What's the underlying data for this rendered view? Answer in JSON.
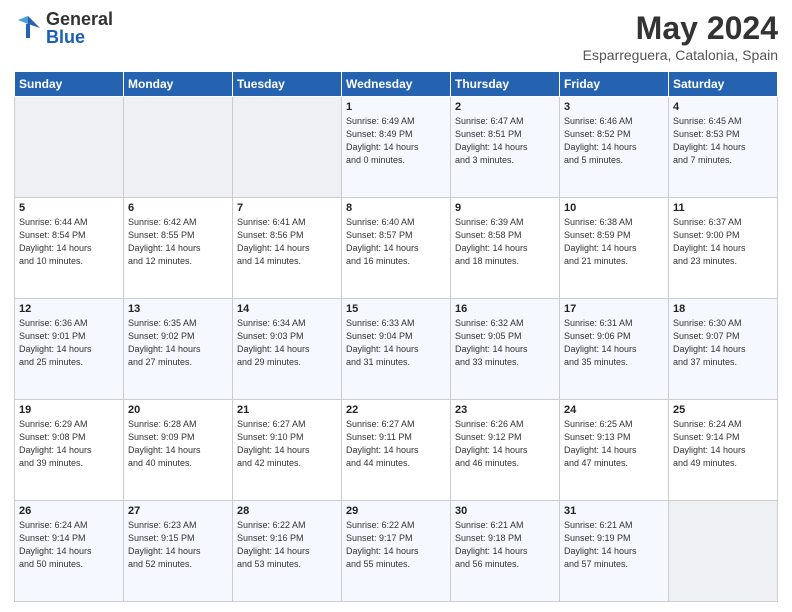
{
  "header": {
    "logo_general": "General",
    "logo_blue": "Blue",
    "month_title": "May 2024",
    "location": "Esparreguera, Catalonia, Spain"
  },
  "weekdays": [
    "Sunday",
    "Monday",
    "Tuesday",
    "Wednesday",
    "Thursday",
    "Friday",
    "Saturday"
  ],
  "weeks": [
    [
      {
        "day": "",
        "info": ""
      },
      {
        "day": "",
        "info": ""
      },
      {
        "day": "",
        "info": ""
      },
      {
        "day": "1",
        "info": "Sunrise: 6:49 AM\nSunset: 8:49 PM\nDaylight: 14 hours\nand 0 minutes."
      },
      {
        "day": "2",
        "info": "Sunrise: 6:47 AM\nSunset: 8:51 PM\nDaylight: 14 hours\nand 3 minutes."
      },
      {
        "day": "3",
        "info": "Sunrise: 6:46 AM\nSunset: 8:52 PM\nDaylight: 14 hours\nand 5 minutes."
      },
      {
        "day": "4",
        "info": "Sunrise: 6:45 AM\nSunset: 8:53 PM\nDaylight: 14 hours\nand 7 minutes."
      }
    ],
    [
      {
        "day": "5",
        "info": "Sunrise: 6:44 AM\nSunset: 8:54 PM\nDaylight: 14 hours\nand 10 minutes."
      },
      {
        "day": "6",
        "info": "Sunrise: 6:42 AM\nSunset: 8:55 PM\nDaylight: 14 hours\nand 12 minutes."
      },
      {
        "day": "7",
        "info": "Sunrise: 6:41 AM\nSunset: 8:56 PM\nDaylight: 14 hours\nand 14 minutes."
      },
      {
        "day": "8",
        "info": "Sunrise: 6:40 AM\nSunset: 8:57 PM\nDaylight: 14 hours\nand 16 minutes."
      },
      {
        "day": "9",
        "info": "Sunrise: 6:39 AM\nSunset: 8:58 PM\nDaylight: 14 hours\nand 18 minutes."
      },
      {
        "day": "10",
        "info": "Sunrise: 6:38 AM\nSunset: 8:59 PM\nDaylight: 14 hours\nand 21 minutes."
      },
      {
        "day": "11",
        "info": "Sunrise: 6:37 AM\nSunset: 9:00 PM\nDaylight: 14 hours\nand 23 minutes."
      }
    ],
    [
      {
        "day": "12",
        "info": "Sunrise: 6:36 AM\nSunset: 9:01 PM\nDaylight: 14 hours\nand 25 minutes."
      },
      {
        "day": "13",
        "info": "Sunrise: 6:35 AM\nSunset: 9:02 PM\nDaylight: 14 hours\nand 27 minutes."
      },
      {
        "day": "14",
        "info": "Sunrise: 6:34 AM\nSunset: 9:03 PM\nDaylight: 14 hours\nand 29 minutes."
      },
      {
        "day": "15",
        "info": "Sunrise: 6:33 AM\nSunset: 9:04 PM\nDaylight: 14 hours\nand 31 minutes."
      },
      {
        "day": "16",
        "info": "Sunrise: 6:32 AM\nSunset: 9:05 PM\nDaylight: 14 hours\nand 33 minutes."
      },
      {
        "day": "17",
        "info": "Sunrise: 6:31 AM\nSunset: 9:06 PM\nDaylight: 14 hours\nand 35 minutes."
      },
      {
        "day": "18",
        "info": "Sunrise: 6:30 AM\nSunset: 9:07 PM\nDaylight: 14 hours\nand 37 minutes."
      }
    ],
    [
      {
        "day": "19",
        "info": "Sunrise: 6:29 AM\nSunset: 9:08 PM\nDaylight: 14 hours\nand 39 minutes."
      },
      {
        "day": "20",
        "info": "Sunrise: 6:28 AM\nSunset: 9:09 PM\nDaylight: 14 hours\nand 40 minutes."
      },
      {
        "day": "21",
        "info": "Sunrise: 6:27 AM\nSunset: 9:10 PM\nDaylight: 14 hours\nand 42 minutes."
      },
      {
        "day": "22",
        "info": "Sunrise: 6:27 AM\nSunset: 9:11 PM\nDaylight: 14 hours\nand 44 minutes."
      },
      {
        "day": "23",
        "info": "Sunrise: 6:26 AM\nSunset: 9:12 PM\nDaylight: 14 hours\nand 46 minutes."
      },
      {
        "day": "24",
        "info": "Sunrise: 6:25 AM\nSunset: 9:13 PM\nDaylight: 14 hours\nand 47 minutes."
      },
      {
        "day": "25",
        "info": "Sunrise: 6:24 AM\nSunset: 9:14 PM\nDaylight: 14 hours\nand 49 minutes."
      }
    ],
    [
      {
        "day": "26",
        "info": "Sunrise: 6:24 AM\nSunset: 9:14 PM\nDaylight: 14 hours\nand 50 minutes."
      },
      {
        "day": "27",
        "info": "Sunrise: 6:23 AM\nSunset: 9:15 PM\nDaylight: 14 hours\nand 52 minutes."
      },
      {
        "day": "28",
        "info": "Sunrise: 6:22 AM\nSunset: 9:16 PM\nDaylight: 14 hours\nand 53 minutes."
      },
      {
        "day": "29",
        "info": "Sunrise: 6:22 AM\nSunset: 9:17 PM\nDaylight: 14 hours\nand 55 minutes."
      },
      {
        "day": "30",
        "info": "Sunrise: 6:21 AM\nSunset: 9:18 PM\nDaylight: 14 hours\nand 56 minutes."
      },
      {
        "day": "31",
        "info": "Sunrise: 6:21 AM\nSunset: 9:19 PM\nDaylight: 14 hours\nand 57 minutes."
      },
      {
        "day": "",
        "info": ""
      }
    ]
  ]
}
